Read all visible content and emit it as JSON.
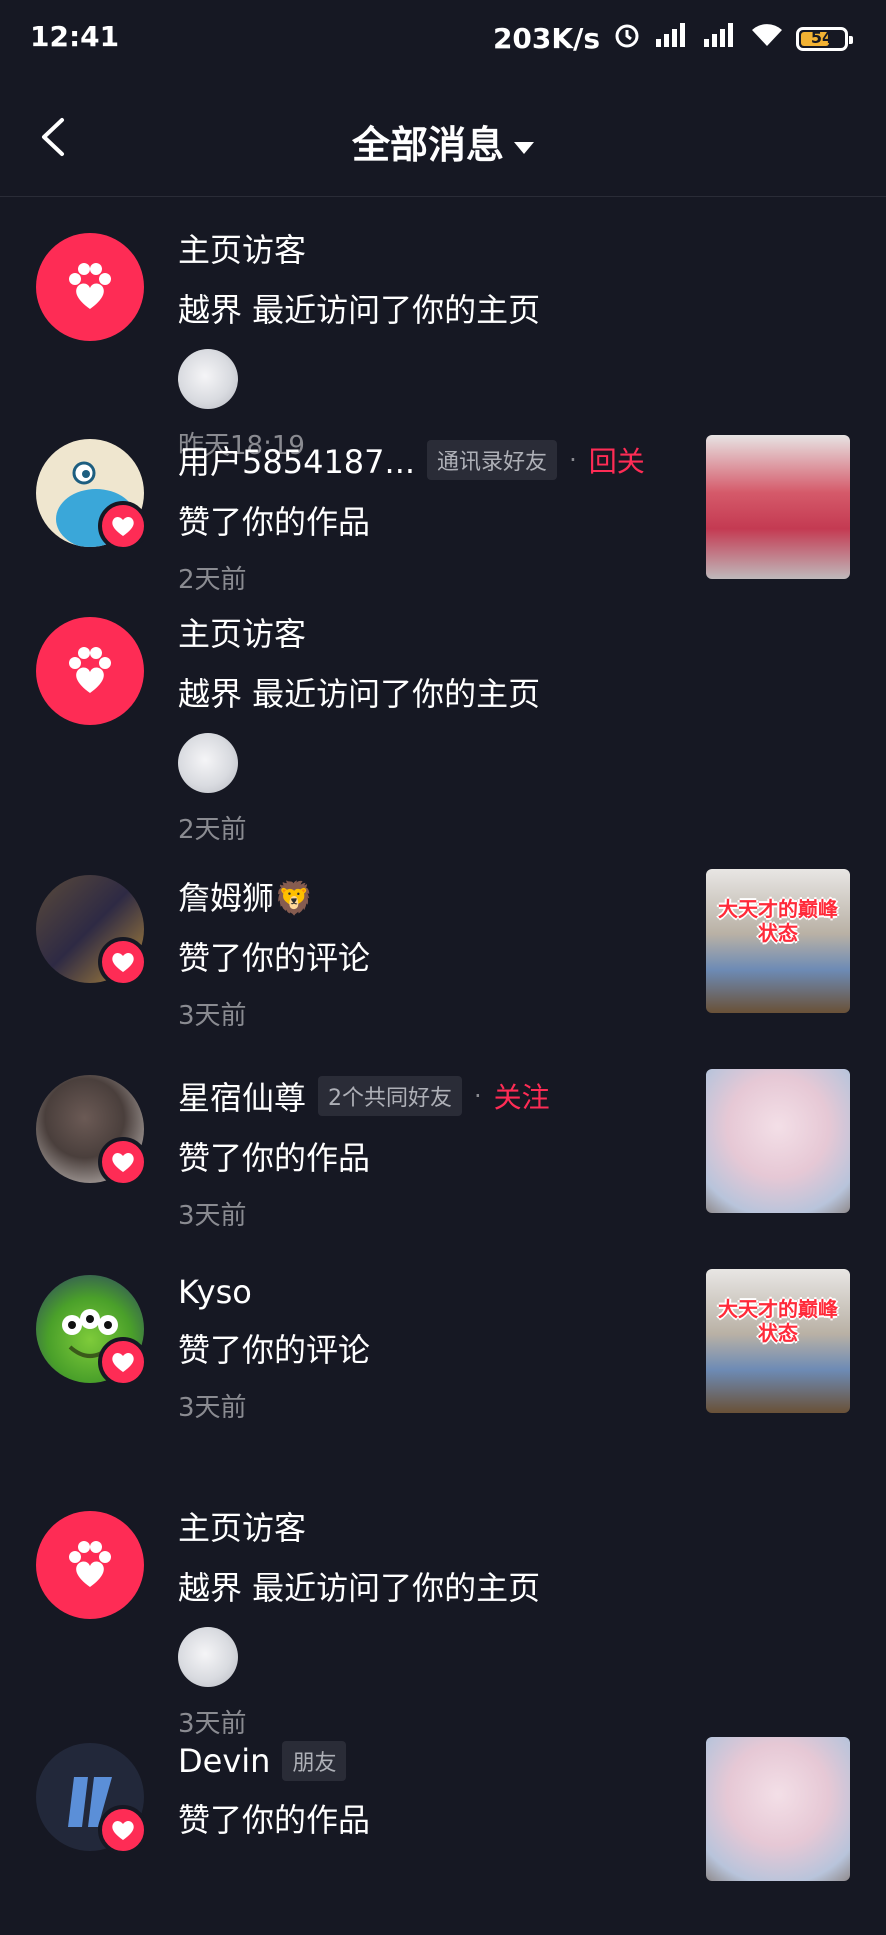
{
  "status": {
    "time": "12:41",
    "net_speed": "203K/s",
    "battery": "54"
  },
  "header": {
    "title": "全部消息"
  },
  "items": [
    {
      "name": "主页访客",
      "desc": "越界 最近访问了你的主页",
      "time": "昨天18:19"
    },
    {
      "name": "用户5854187...",
      "tag": "通讯录好友",
      "dot": "·",
      "action": "回关",
      "desc": "赞了你的作品",
      "time": "2天前"
    },
    {
      "name": "主页访客",
      "desc": "越界 最近访问了你的主页",
      "time": "2天前"
    },
    {
      "name": "詹姆狮🦁",
      "desc": "赞了你的评论",
      "time": "3天前",
      "thumb_caption": "大天才的巅峰状态"
    },
    {
      "name": "星宿仙尊",
      "tag": "2个共同好友",
      "dot": "·",
      "action": "关注",
      "desc": "赞了你的作品",
      "time": "3天前"
    },
    {
      "name": "Kyso",
      "desc": "赞了你的评论",
      "time": "3天前",
      "thumb_caption": "大天才的巅峰状态"
    },
    {
      "name": "主页访客",
      "desc": "越界 最近访问了你的主页",
      "time": "3天前"
    },
    {
      "name": "Devin",
      "tag": "朋友",
      "desc": "赞了你的作品"
    }
  ],
  "colors": {
    "accent": "#fe2c55",
    "background": "#161823"
  }
}
